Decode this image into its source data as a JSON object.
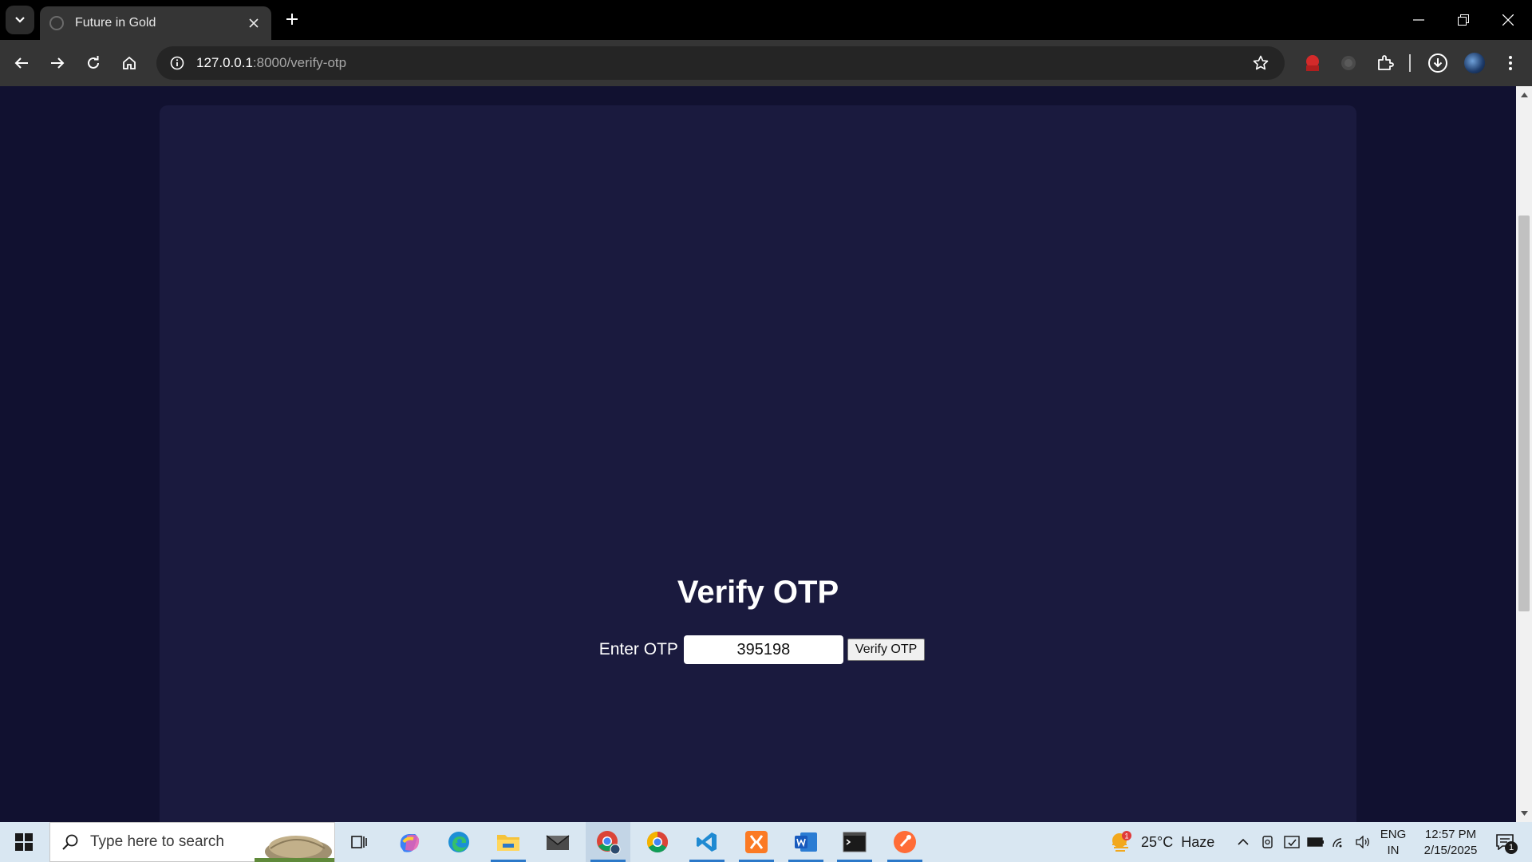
{
  "browser": {
    "tab_title": "Future in Gold",
    "url_host": "127.0.0.1",
    "url_path": ":8000/verify-otp"
  },
  "page": {
    "heading": "Verify OTP",
    "otp_label": "Enter OTP",
    "otp_value": "395198",
    "submit_label": "Verify OTP",
    "background_color": "#111130",
    "card_color": "#1a1a3e"
  },
  "taskbar": {
    "search_placeholder": "Type here to search",
    "weather": "25°C  Haze",
    "weather_alert": "1",
    "lang_top": "ENG",
    "lang_bottom": "IN",
    "time": "12:57 PM",
    "date": "2/15/2025",
    "notification_count": "1"
  }
}
